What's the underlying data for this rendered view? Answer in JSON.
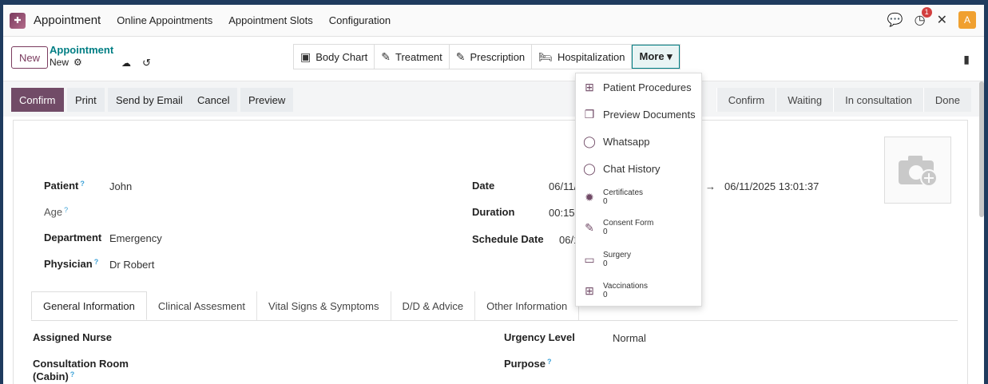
{
  "navbar": {
    "app_name": "Appointment",
    "menu": [
      "Online Appointments",
      "Appointment Slots",
      "Configuration"
    ],
    "activity_badge": "1",
    "avatar_letter": "A"
  },
  "control": {
    "new_label": "New",
    "breadcrumb_parent": "Appointment",
    "breadcrumb_current": "New"
  },
  "smart_buttons": {
    "body_chart": "Body Chart",
    "treatment": "Treatment",
    "prescription": "Prescription",
    "hospitalization": "Hospitalization",
    "more": "More ▾"
  },
  "actions": {
    "confirm": "Confirm",
    "print": "Print",
    "send_email": "Send by Email",
    "cancel": "Cancel",
    "preview": "Preview"
  },
  "stages": [
    "Confirm",
    "Waiting",
    "In consultation",
    "Done"
  ],
  "form": {
    "patient_label": "Patient",
    "patient_value": "John",
    "age_label": "Age",
    "department_label": "Department",
    "department_value": "Emergency",
    "physician_label": "Physician",
    "physician_value": "Dr Robert",
    "date_label": "Date",
    "date_value": "06/11/",
    "date_end": "06/11/2025 13:01:37",
    "duration_label": "Duration",
    "duration_value": "00:15",
    "schedule_label": "Schedule Date",
    "schedule_value": "06/12/"
  },
  "tabs": [
    "General Information",
    "Clinical Assesment",
    "Vital Signs & Symptoms",
    "D/D & Advice",
    "Other Information"
  ],
  "general": {
    "assigned_nurse": "Assigned Nurse",
    "consultation_room_1": "Consultation Room",
    "consultation_room_2": "(Cabin)",
    "urgency_label": "Urgency Level",
    "urgency_value": "Normal",
    "purpose_label": "Purpose"
  },
  "more_menu": {
    "patient_procedures": "Patient Procedures",
    "preview_documents": "Preview Documents",
    "whatsapp": "Whatsapp",
    "chat_history": "Chat History",
    "certificates": {
      "label": "Certificates",
      "count": "0"
    },
    "consent_form": {
      "label": "Consent Form",
      "count": "0"
    },
    "surgery": {
      "label": "Surgery",
      "count": "0"
    },
    "vaccinations": {
      "label": "Vaccinations",
      "count": "0"
    }
  },
  "colors": {
    "primary": "#714b67",
    "teal": "#017e84",
    "background": "#1f3b5e"
  }
}
